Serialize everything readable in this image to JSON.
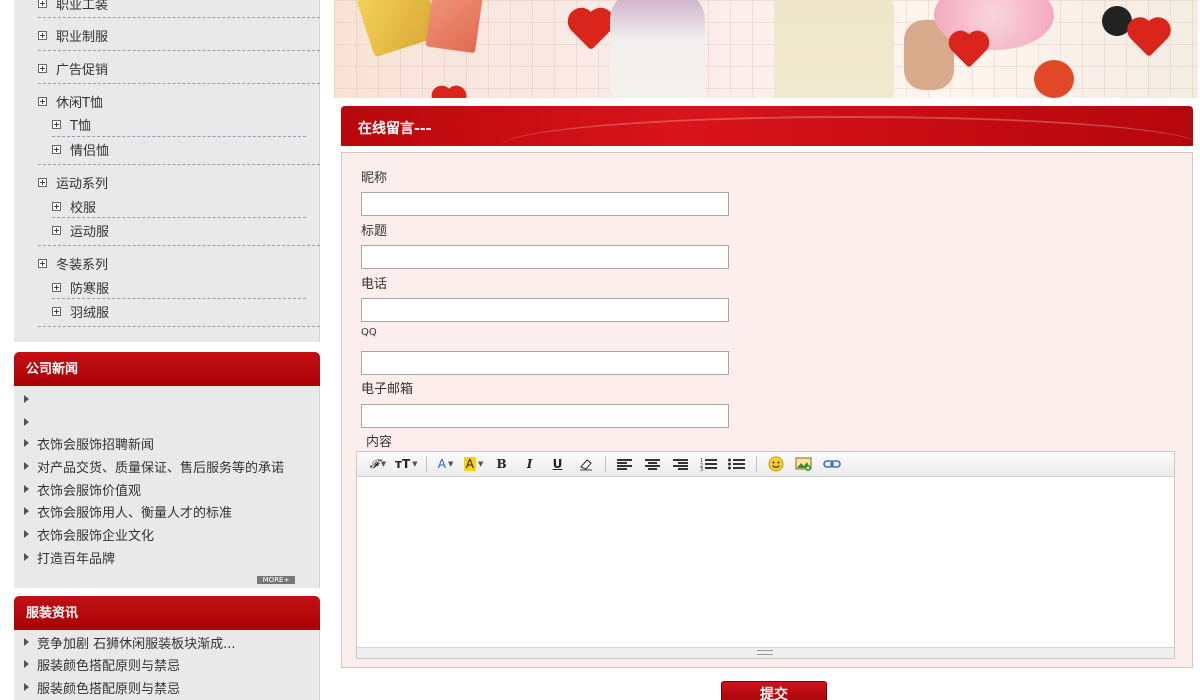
{
  "categories": {
    "rows": [
      {
        "label": "职业工装",
        "sub": false
      },
      {
        "label": "职业制服",
        "sub": false
      },
      {
        "label": "广告促销",
        "sub": false
      },
      {
        "label": "休闲T恤",
        "sub": false
      },
      {
        "label": "T恤",
        "sub": true
      },
      {
        "label": "情侣恤",
        "sub": true
      },
      {
        "label": "运动系列",
        "sub": false
      },
      {
        "label": "校服",
        "sub": true
      },
      {
        "label": "运动服",
        "sub": true
      },
      {
        "label": "冬装系列",
        "sub": false
      },
      {
        "label": "防寒服",
        "sub": true
      },
      {
        "label": "羽绒服",
        "sub": true
      }
    ]
  },
  "company_news": {
    "title": "公司新闻",
    "items": [
      "",
      "",
      "衣饰会服饰招聘新闻",
      "对产品交货、质量保证、售后服务等的承诺",
      "衣饰会服饰价值观",
      "衣饰会服饰用人、衡量人才的标准",
      "衣饰会服饰企业文化",
      "打造百年品牌"
    ],
    "more_label": "MORE+"
  },
  "fashion_info": {
    "title": "服装资讯",
    "items": [
      "竞争加剧 石狮休闲服装板块渐成...",
      "服装颜色搭配原则与禁忌",
      "服装颜色搭配原则与禁忌"
    ]
  },
  "message_form": {
    "title": "在线留言---",
    "fields": [
      {
        "label": "昵称",
        "value": ""
      },
      {
        "label": "标题",
        "value": ""
      },
      {
        "label": "电话",
        "value": ""
      },
      {
        "label": "QQ",
        "value": ""
      },
      {
        "label": "电子邮箱",
        "value": ""
      }
    ],
    "content_label": "内容",
    "submit_label": "提交"
  },
  "toolbar": {
    "font_family_glyph": "𝓕",
    "font_size_glyph": "тT",
    "font_color_glyph": "A",
    "highlight_glyph": "A",
    "bold_glyph": "B",
    "italic_glyph": "I",
    "underline_glyph": "U"
  },
  "colors": {
    "accent_red": "#c41014",
    "form_bg": "#fdeeee",
    "panel_gray": "#e9e9e9"
  }
}
